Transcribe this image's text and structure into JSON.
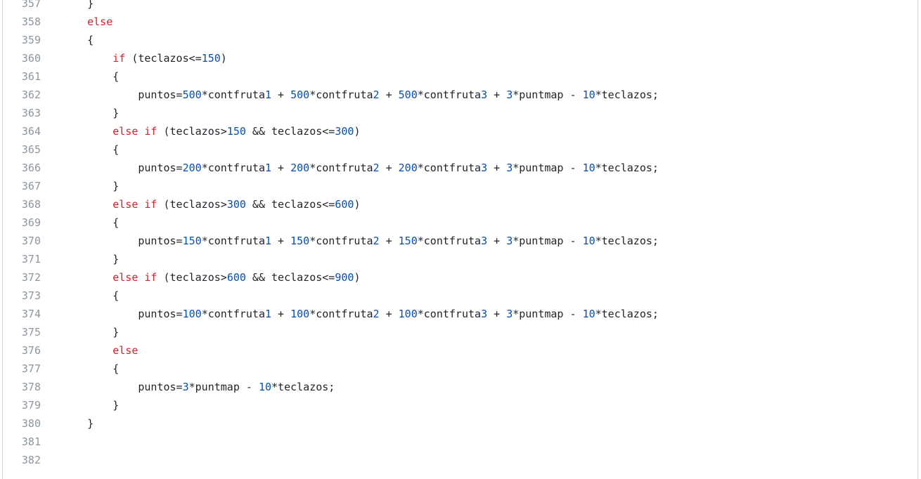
{
  "editor": {
    "lines": [
      {
        "num": "357",
        "code": "    }"
      },
      {
        "num": "358",
        "code": "    else"
      },
      {
        "num": "359",
        "code": "    {"
      },
      {
        "num": "360",
        "code": "        if (teclazos<=150)"
      },
      {
        "num": "361",
        "code": "        {"
      },
      {
        "num": "362",
        "code": "            puntos=500*contfruta1 + 500*contfruta2 + 500*contfruta3 + 3*puntmap - 10*teclazos;"
      },
      {
        "num": "363",
        "code": "        }"
      },
      {
        "num": "364",
        "code": "        else if (teclazos>150 && teclazos<=300)"
      },
      {
        "num": "365",
        "code": "        {"
      },
      {
        "num": "366",
        "code": "            puntos=200*contfruta1 + 200*contfruta2 + 200*contfruta3 + 3*puntmap - 10*teclazos;"
      },
      {
        "num": "367",
        "code": "        }"
      },
      {
        "num": "368",
        "code": "        else if (teclazos>300 && teclazos<=600)"
      },
      {
        "num": "369",
        "code": "        {"
      },
      {
        "num": "370",
        "code": "            puntos=150*contfruta1 + 150*contfruta2 + 150*contfruta3 + 3*puntmap - 10*teclazos;"
      },
      {
        "num": "371",
        "code": "        }"
      },
      {
        "num": "372",
        "code": "        else if (teclazos>600 && teclazos<=900)"
      },
      {
        "num": "373",
        "code": "        {"
      },
      {
        "num": "374",
        "code": "            puntos=100*contfruta1 + 100*contfruta2 + 100*contfruta3 + 3*puntmap - 10*teclazos;"
      },
      {
        "num": "375",
        "code": "        }"
      },
      {
        "num": "376",
        "code": "        else"
      },
      {
        "num": "377",
        "code": "        {"
      },
      {
        "num": "378",
        "code": "            puntos=3*puntmap - 10*teclazos;"
      },
      {
        "num": "379",
        "code": "        }"
      },
      {
        "num": "380",
        "code": "    }"
      },
      {
        "num": "381",
        "code": ""
      },
      {
        "num": "382",
        "code": ""
      }
    ]
  },
  "colors": {
    "keyword": "#cf222e",
    "number": "#0550ae",
    "text": "#1f2328",
    "line_number": "#8c959f"
  }
}
